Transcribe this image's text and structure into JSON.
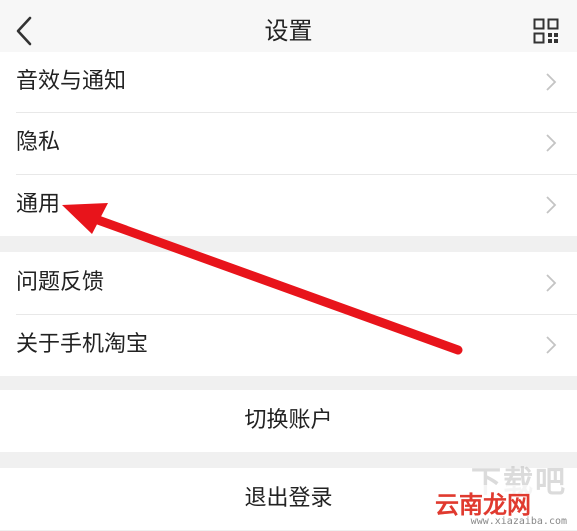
{
  "nav": {
    "title": "设置",
    "back_icon": "chevron-left-icon",
    "right_icon": "qr-code-icon"
  },
  "groups": [
    {
      "items": [
        {
          "label": "音效与通知"
        },
        {
          "label": "隐私"
        },
        {
          "label": "通用"
        }
      ]
    },
    {
      "items": [
        {
          "label": "问题反馈"
        },
        {
          "label": "关于手机淘宝"
        }
      ]
    }
  ],
  "buttons": {
    "switch_account": "切换账户",
    "logout": "退出登录"
  },
  "annotation": {
    "arrow_color": "#e8141b",
    "target_item": "通用"
  },
  "watermark": {
    "top_text": "下载吧",
    "brand": "云南龙网",
    "url": "www.xiazaiba.com"
  },
  "colors": {
    "background": "#f0f0f0",
    "nav_background": "#f7f7f7",
    "text": "#222222",
    "chevron": "#c4c4c4"
  }
}
